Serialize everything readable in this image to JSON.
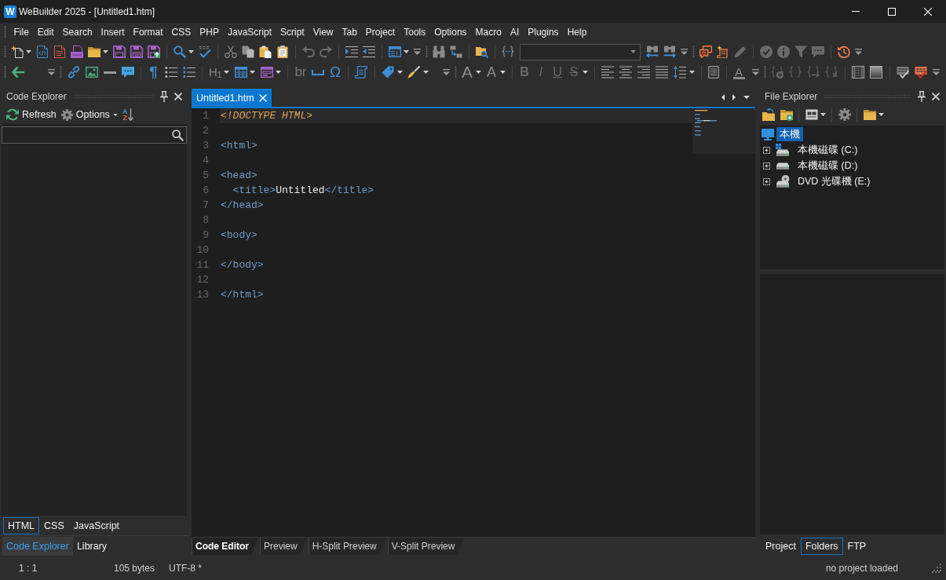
{
  "window": {
    "logo_letter": "W",
    "title": "WeBuilder 2025 - [Untitled1.htm]"
  },
  "menu": [
    {
      "label": "File"
    },
    {
      "label": "Edit"
    },
    {
      "label": "Search"
    },
    {
      "label": "Insert"
    },
    {
      "label": "Format"
    },
    {
      "label": "CSS"
    },
    {
      "label": "PHP"
    },
    {
      "label": "JavaScript"
    },
    {
      "label": "Script"
    },
    {
      "label": "View"
    },
    {
      "label": "Tab"
    },
    {
      "label": "Project"
    },
    {
      "label": "Tools"
    },
    {
      "label": "Options"
    },
    {
      "label": "Macro"
    },
    {
      "label": "AI"
    },
    {
      "label": "Plugins"
    },
    {
      "label": "Help"
    }
  ],
  "toolbars": {
    "glyph_buttons": [
      {
        "kind": "pilcrow",
        "text": "¶"
      },
      {
        "kind": "heading",
        "text": "H$_{1}$"
      },
      {
        "kind": "line-break",
        "text": "br"
      },
      {
        "kind": "symbol",
        "text": "Ω"
      },
      {
        "kind": "font",
        "text": "A"
      },
      {
        "kind": "font-effects",
        "text": "A"
      },
      {
        "kind": "bold",
        "text": "B"
      },
      {
        "kind": "italic",
        "text": "I"
      },
      {
        "kind": "underline",
        "text": "U"
      },
      {
        "kind": "strikethrough",
        "text": "S"
      },
      {
        "kind": "font-color",
        "text": "A"
      }
    ]
  },
  "code_explorer": {
    "title": "Code Explorer",
    "refresh_label": "Refresh",
    "options_label": "Options",
    "sort_letters": [
      "A",
      "Z"
    ],
    "language_tabs": [
      {
        "label": "HTML",
        "selected": true
      },
      {
        "label": "CSS",
        "selected": false
      },
      {
        "label": "JavaScript",
        "selected": false
      }
    ],
    "panel_tabs": [
      {
        "label": "Code Explorer",
        "selected": true
      },
      {
        "label": "Library",
        "selected": false
      }
    ]
  },
  "editor": {
    "tabs": [
      {
        "label": "Untitled1.htm",
        "selected": true
      }
    ],
    "lines": [
      {
        "number": "1",
        "current": true,
        "tokens": [
          {
            "kind": "doctype",
            "text": "<!DOCTYPE HTML>"
          }
        ]
      },
      {
        "number": "2",
        "current": false
      },
      {
        "number": "3",
        "current": false,
        "tokens": [
          {
            "kind": "tag",
            "text": "<html>"
          }
        ]
      },
      {
        "number": "4",
        "current": false
      },
      {
        "number": "5",
        "current": false,
        "tokens": [
          {
            "kind": "tag",
            "text": "<head>"
          }
        ]
      },
      {
        "number": "6",
        "current": false,
        "indented": true,
        "tokens": [
          {
            "kind": "tag",
            "text": "<title>"
          },
          {
            "kind": "text",
            "text": "Untitled"
          },
          {
            "kind": "tag",
            "text": "</title>"
          }
        ]
      },
      {
        "number": "7",
        "current": false,
        "tokens": [
          {
            "kind": "tag",
            "text": "</head>"
          }
        ]
      },
      {
        "number": "8",
        "current": false
      },
      {
        "number": "9",
        "current": false,
        "tokens": [
          {
            "kind": "tag",
            "text": "<body>"
          }
        ]
      },
      {
        "number": "10",
        "current": false
      },
      {
        "number": "11",
        "current": false,
        "tokens": [
          {
            "kind": "tag",
            "text": "</body>"
          }
        ]
      },
      {
        "number": "12",
        "current": false
      },
      {
        "number": "13",
        "current": false,
        "tokens": [
          {
            "kind": "tag",
            "text": "</html>"
          }
        ]
      }
    ],
    "view_tabs": [
      {
        "label": "Code Editor",
        "selected": true
      },
      {
        "label": "Preview",
        "selected": false
      },
      {
        "label": "H-Split Preview",
        "selected": false
      },
      {
        "label": "V-Split Preview",
        "selected": false
      }
    ]
  },
  "file_explorer": {
    "title": "File Explorer",
    "tree": [
      {
        "label": "本機",
        "kind": "computer",
        "selected": true,
        "children": [
          {
            "label": "本機磁碟 (C:)",
            "kind": "system-disk",
            "selected": false,
            "expanded": false
          },
          {
            "label": "本機磁碟 (D:)",
            "kind": "disk",
            "selected": false,
            "expanded": false
          },
          {
            "label": "DVD 光碟機 (E:)",
            "kind": "optical-disk",
            "selected": false,
            "expanded": false
          }
        ]
      }
    ],
    "panel_tabs": [
      {
        "label": "Project",
        "selected": false
      },
      {
        "label": "Folders",
        "selected": true
      },
      {
        "label": "FTP",
        "selected": false
      }
    ]
  },
  "status_bar": {
    "cursor_position": "1 : 1",
    "file_size": "105 bytes",
    "encoding": "UTF-8 *",
    "project_status": "no project loaded"
  }
}
